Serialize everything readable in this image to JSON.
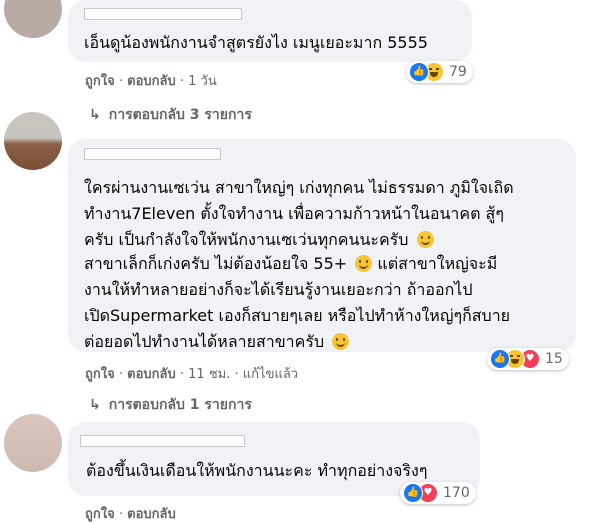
{
  "comments": [
    {
      "text": "เอ็นดูน้องพนักงานจำสูตรยังไง เมนูเยอะมาก 5555",
      "meta": {
        "like": "ถูกใจ",
        "reply": "ตอบกลับ",
        "time": "1 วัน"
      },
      "reactions": {
        "icons": [
          "like-icon",
          "haha-icon"
        ],
        "count": "79"
      },
      "replies_link": "การตอบกลับ 3 รายการ"
    },
    {
      "paragraphs": [
        [
          "ใครผ่านงานเซเว่น สาขาใหญ่ๆ เก่งทุกคน ไม่ธรรมดา ภูมิใจเถิด",
          "ทำงาน7Eleven ตั้งใจทำงาน เพื่อความก้าวหน้าในอนาคต สู้ๆ",
          "ครับ เป็นกำลังใจให้พนักงานเซเว่นทุกคนนะครับ"
        ],
        [
          "สาขาเล็กก็เก่งครับ ไม่ต้องน้อยใจ 55+",
          "แต่สาขาใหญ่จะมี",
          "งานให้ทำหลายอย่างก็จะได้เรียนรู้งานเยอะกว่า ถ้าออกไป",
          "เปิดSupermarket เองก็สบายๆเลย หรือไปทำห้างใหญ่ๆก็สบาย",
          "ต่อยอดไปทำงานได้หลายสาขาครับ"
        ]
      ],
      "meta": {
        "like": "ถูกใจ",
        "reply": "ตอบกลับ",
        "time": "11 ชม.",
        "edited": "แก้ไขแล้ว"
      },
      "reactions": {
        "icons": [
          "like-icon",
          "haha-icon",
          "love-icon"
        ],
        "count": "15"
      },
      "replies_link": "การตอบกลับ 1 รายการ"
    },
    {
      "text": "ต้องขึ้นเงินเดือนให้พนักงานนะคะ ทำทุกอย่างจริงๆ",
      "meta": {
        "like": "ถูกใจ",
        "reply": "ตอบกลับ"
      },
      "reactions": {
        "icons": [
          "like-icon",
          "love-icon"
        ],
        "count": "170"
      }
    }
  ],
  "separator": "·",
  "reply_arrow": "↳",
  "colors": {
    "bubble": "#f0f2f5",
    "meta": "#65676b",
    "like": "#1877f2",
    "love": "#f33e58",
    "haha": "#f7c531"
  }
}
